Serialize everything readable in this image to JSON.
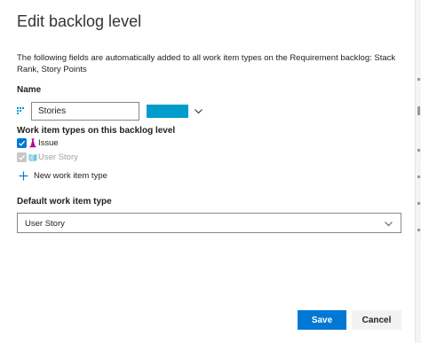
{
  "dialog": {
    "title": "Edit backlog level",
    "description": "The following fields are automatically added to all work item types on the Requirement backlog: Stack Rank, Story Points"
  },
  "name_section": {
    "label": "Name",
    "input_value": "Stories",
    "icon": "backlog-icon",
    "color": "#009ccc"
  },
  "work_item_types": {
    "label": "Work item types on this backlog level",
    "items": [
      {
        "label": "Issue",
        "checked": true,
        "disabled": false,
        "icon": "issue-icon",
        "icon_color": "#b4009e"
      },
      {
        "label": "User Story",
        "checked": true,
        "disabled": true,
        "icon": "user-story-icon",
        "icon_color": "#009ccc"
      }
    ],
    "add_label": "New work item type"
  },
  "default_type": {
    "label": "Default work item type",
    "selected": "User Story"
  },
  "footer": {
    "save_label": "Save",
    "cancel_label": "Cancel"
  },
  "colors": {
    "accent": "#0078d4",
    "checkbox_checked": "#0078d4",
    "checkbox_disabled": "#c8c6c4"
  }
}
